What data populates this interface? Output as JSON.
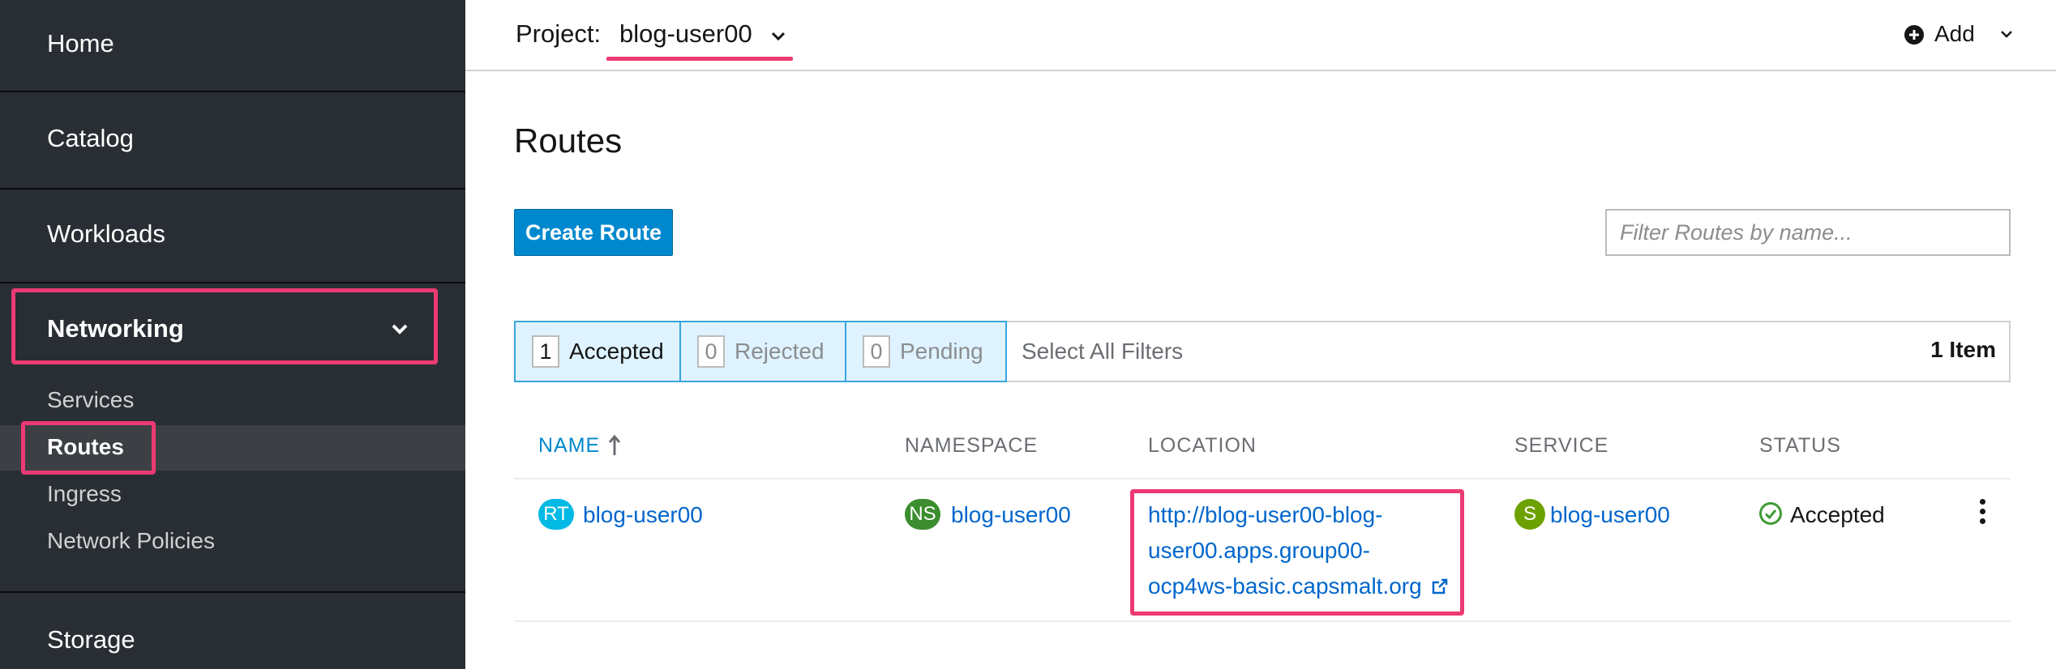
{
  "sidebar": {
    "home": "Home",
    "catalog": "Catalog",
    "workloads": "Workloads",
    "networking": "Networking",
    "networking_items": [
      "Services",
      "Routes",
      "Ingress",
      "Network Policies"
    ],
    "storage": "Storage"
  },
  "topbar": {
    "project_label": "Project:",
    "project_value": "blog-user00",
    "add_label": "Add"
  },
  "page": {
    "title": "Routes",
    "create_button": "Create Route",
    "filter_placeholder": "Filter Routes by name..."
  },
  "filters": {
    "chips": [
      {
        "count": "1",
        "label": "Accepted"
      },
      {
        "count": "0",
        "label": "Rejected"
      },
      {
        "count": "0",
        "label": "Pending"
      }
    ],
    "select_all": "Select All Filters",
    "item_count": "1 Item"
  },
  "table": {
    "columns": [
      "NAME",
      "NAMESPACE",
      "LOCATION",
      "SERVICE",
      "STATUS"
    ],
    "rows": [
      {
        "name_badge": "RT",
        "name": "blog-user00",
        "namespace_badge": "NS",
        "namespace": "blog-user00",
        "location_lines": [
          "http://blog-user00-blog-",
          "user00.apps.group00-",
          "ocp4ws-basic.capsmalt.org"
        ],
        "service_badge": "S",
        "service": "blog-user00",
        "status": "Accepted"
      }
    ]
  },
  "colors": {
    "accent": "#0088ce",
    "link": "#0066cc",
    "highlight": "#ec3a73",
    "sidebar_bg": "#292e34",
    "badge_route": "#00b9e4",
    "badge_namespace": "#3c8d2f",
    "badge_service": "#6ca100",
    "status_ok": "#3f9c35"
  }
}
